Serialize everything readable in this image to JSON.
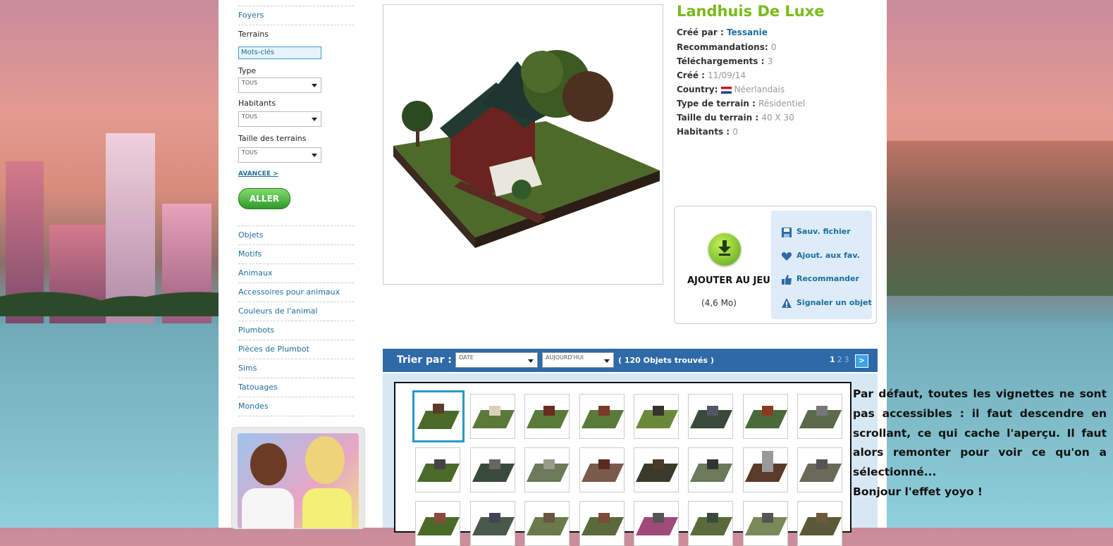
{
  "sidebar": {
    "links_top": [
      "Foyers"
    ],
    "section_title": "Terrains",
    "keyword_box": "Mots-clés",
    "filters": [
      {
        "label": "Type",
        "value": "TOUS"
      },
      {
        "label": "Habitants",
        "value": "TOUS"
      },
      {
        "label": "Taille des terrains",
        "value": "TOUS"
      }
    ],
    "advanced": "AVANCEE >",
    "go_button": "ALLER",
    "categories": [
      "Objets",
      "Motifs",
      "Animaux",
      "Accessoires pour animaux",
      "Couleurs de l'animal",
      "Plumbots",
      "Pièces de Plumbot",
      "Sims",
      "Tatouages",
      "Mondes"
    ]
  },
  "lot": {
    "title": "Landhuis De Luxe",
    "created_by_label": "Créé par :",
    "creator": "Tessanie",
    "recommendations_label": "Recommandations:",
    "recommendations": "0",
    "downloads_label": "Téléchargements :",
    "downloads": "3",
    "created_label": "Créé :",
    "created": "11/09/14",
    "country_label": "Country:",
    "country": "Néerlandais",
    "lot_type_label": "Type de terrain :",
    "lot_type": "Résidentiel",
    "lot_size_label": "Taille du terrain :",
    "lot_size": "40 X 30",
    "residents_label": "Habitants :",
    "residents": "0"
  },
  "download": {
    "title": "AJOUTER AU JEU",
    "size": "(4,6 Mo)",
    "actions": [
      {
        "label": "Sauv. fichier",
        "icon": "save-icon"
      },
      {
        "label": "Ajout. aux fav.",
        "icon": "heart-icon"
      },
      {
        "label": "Recommander",
        "icon": "thumbs-up-icon"
      },
      {
        "label": "Signaler un objet",
        "icon": "warning-icon"
      }
    ]
  },
  "sort": {
    "label": "Trier par :",
    "sort_by": "DATE",
    "period": "AUJOURD'HUI",
    "found": "( 120 Objets trouvés )",
    "pages": [
      "1",
      "2",
      "3"
    ],
    "next": ">"
  },
  "annotation": {
    "text": "Par défaut, toutes les vignettes ne sont pas accessibles : il faut descendre en scrollant, ce qui cache l'aperçu. Il faut alors remonter pour voir ce qu'on a sélectionné...",
    "text2": "Bonjour l'effet yoyo !"
  },
  "colors": {
    "accent_green": "#79bb1a",
    "link_blue": "#1c6f9e",
    "sortbar_blue": "#2f6aa8"
  }
}
